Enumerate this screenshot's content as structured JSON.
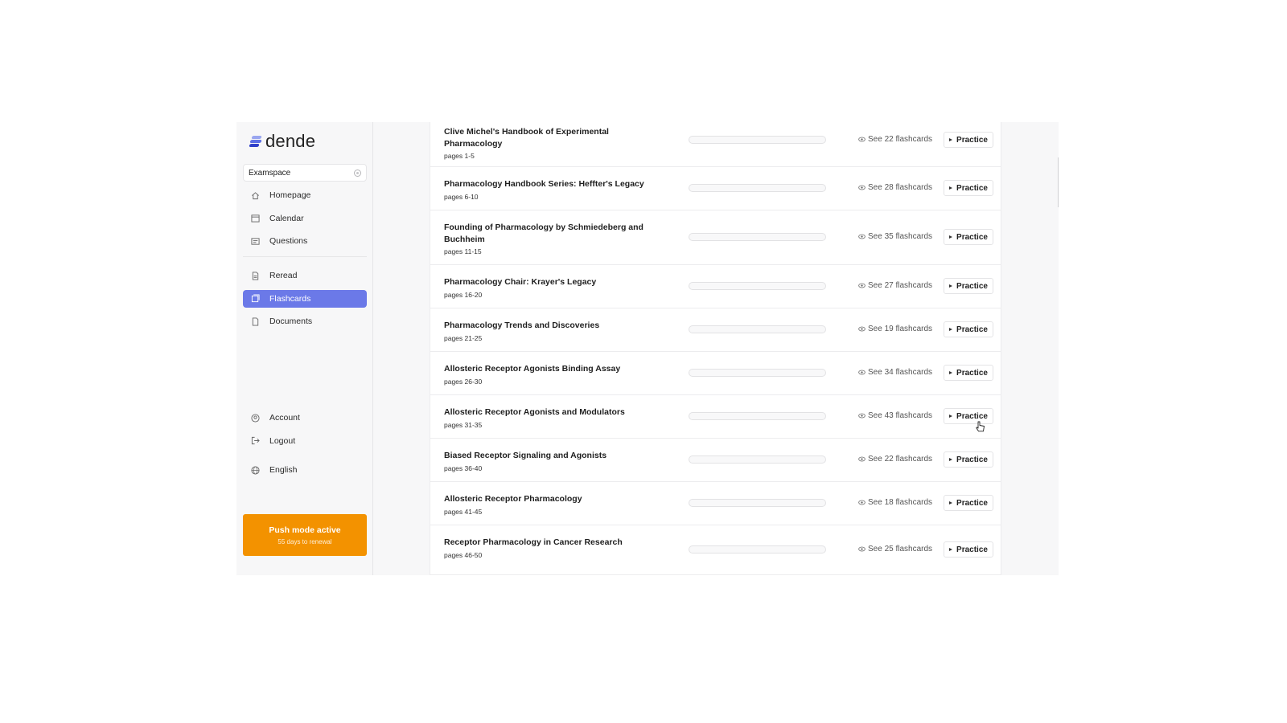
{
  "app": {
    "name": "dende"
  },
  "sidebar": {
    "workspace": "Examspace",
    "nav_top": [
      {
        "label": "Homepage",
        "icon": "home-icon"
      },
      {
        "label": "Calendar",
        "icon": "calendar-icon"
      },
      {
        "label": "Questions",
        "icon": "questions-icon"
      }
    ],
    "nav_mid": [
      {
        "label": "Reread",
        "icon": "reread-icon"
      },
      {
        "label": "Flashcards",
        "icon": "flashcards-icon",
        "active": true
      },
      {
        "label": "Documents",
        "icon": "document-icon"
      }
    ],
    "nav_bottom": [
      {
        "label": "Account",
        "icon": "account-icon"
      },
      {
        "label": "Logout",
        "icon": "logout-icon"
      }
    ],
    "language": {
      "label": "English",
      "icon": "globe-icon"
    },
    "push": {
      "title": "Push mode active",
      "subtitle": "55 days to renewal"
    }
  },
  "colors": {
    "accent": "#6b79e8",
    "push": "#f39200"
  },
  "list": {
    "practice_label": "Practice",
    "rows": [
      {
        "title": "Clive Michel's Handbook of Experimental Pharmacology",
        "pages": "pages 1-5",
        "see": "See 22 flashcards"
      },
      {
        "title": "Pharmacology Handbook Series: Heffter's Legacy",
        "pages": "pages 6-10",
        "see": "See 28 flashcards"
      },
      {
        "title": "Founding of Pharmacology by Schmiedeberg and Buchheim",
        "pages": "pages 11-15",
        "see": "See 35 flashcards"
      },
      {
        "title": "Pharmacology Chair: Krayer's Legacy",
        "pages": "pages 16-20",
        "see": "See 27 flashcards"
      },
      {
        "title": "Pharmacology Trends and Discoveries",
        "pages": "pages 21-25",
        "see": "See 19 flashcards"
      },
      {
        "title": "Allosteric Receptor Agonists Binding Assay",
        "pages": "pages 26-30",
        "see": "See 34 flashcards"
      },
      {
        "title": "Allosteric Receptor Agonists and Modulators",
        "pages": "pages 31-35",
        "see": "See 43 flashcards"
      },
      {
        "title": "Biased Receptor Signaling and Agonists",
        "pages": "pages 36-40",
        "see": "See 22 flashcards"
      },
      {
        "title": "Allosteric Receptor Pharmacology",
        "pages": "pages 41-45",
        "see": "See 18 flashcards"
      },
      {
        "title": "Receptor Pharmacology in Cancer Research",
        "pages": "pages 46-50",
        "see": "See 25 flashcards"
      }
    ]
  }
}
